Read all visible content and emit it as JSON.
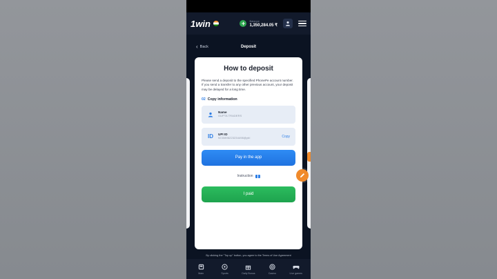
{
  "header": {
    "logo_text": "1win",
    "balance_label": "Balance",
    "balance_value": "1,350,284.05 ₹"
  },
  "nav_bar": {
    "back_label": "Back",
    "title": "Deposit"
  },
  "card": {
    "title": "How to deposit",
    "note": "Please send a deposit to the specified PhonePe account number. If you send a transfer to any other previous account, your deposit may be delayed for a long time.",
    "step_number": "02",
    "step_label": "Copy information",
    "name_label": "Name",
    "name_value": "GUPTA TRADERS",
    "upi_icon_text": "ID",
    "upi_label": "UPI ID",
    "upi_value": "9230896223234498@ybl",
    "copy_label": "Copy",
    "pay_button": "Pay in the app",
    "instruction_label": "Instruction",
    "paid_button": "I paid"
  },
  "footer": {
    "terms": "By clicking the \"Top up\" button, you agree to the Terms of Use Agreement",
    "items": [
      {
        "label": "Main",
        "icon": "home-icon"
      },
      {
        "label": "Sports",
        "icon": "soccer-ball-icon"
      },
      {
        "label": "Daily Bonus",
        "icon": "gift-icon"
      },
      {
        "label": "Casino",
        "icon": "chip-icon"
      },
      {
        "label": "Live games",
        "icon": "gamepad-icon"
      }
    ]
  },
  "colors": {
    "accent_blue": "#2f7fe6",
    "success_green": "#1ea34e",
    "fab_orange": "#f08a2b",
    "app_bg": "#0b1322"
  }
}
